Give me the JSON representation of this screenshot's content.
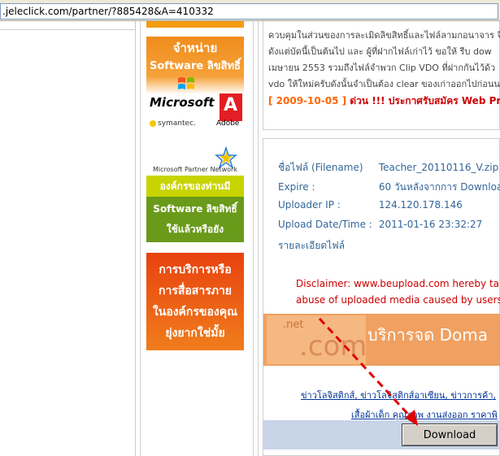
{
  "address_bar": {
    "url": ".jeleclick.com/partner/?885428&A=410332"
  },
  "banners": {
    "banner1": {
      "line1": "จำหน่าย",
      "line2": "Software ลิขสิทธิ์",
      "brand1": "Microsoft",
      "brand2": "symantec.",
      "brand3": "Adobe"
    },
    "banner2": {
      "network": "Microsoft Partner Network",
      "line1": "องค์กรของท่านมี",
      "line2": "Software ลิขสิทธิ์",
      "line3": "ใช้แล้วหรือยัง"
    },
    "banner3": {
      "line1": "การบริการหรือ",
      "line2": "การสื่อสารภาย",
      "line3": "ในองค์กรของคุณ",
      "line4": "ยุ่งยากใช่มั้ย"
    }
  },
  "news": {
    "lines": [
      "ควบคุมในส่วนของการละเมิดลิขสิทธิ์และไฟล์ลามกอนาจาร จึ",
      "ดังแต่บัดนี้เป็นต้นไป และ ผู้ที่ฝากไฟล์เก่าไว้ ขอให้ รีบ dow",
      "เมษายน 2553 รวมถึงไฟล์จำพวก Clip VDO ที่ฝากกันไว้ด้ว",
      "vdo ให้ใหม่ครับดังนั้นจำเป็นต้อง clear ของเก่าออกไปก่อนน"
    ],
    "date": "[ 2009-10-05 ]",
    "headline": "ด่วน !!! ประกาศรับสมัคร Web Pro"
  },
  "file_info": {
    "filename_label": "ชื่อไฟล์ (Filename)",
    "filename": "Teacher_20110116_V.zip",
    "expire_label": "Expire :",
    "expire": "60 วันหลังจากการ Downloa",
    "uploader_label": "Uploader IP :",
    "uploader_ip": "124.120.178.146",
    "date_label": "Upload Date/Time :",
    "date": "2011-01-16 23:32:27",
    "details_label": "รายละเอียดไฟล์"
  },
  "disclaimer": {
    "line1": "Disclaimer: www.beupload.com hereby takes",
    "line2": "abuse of uploaded media caused by users of "
  },
  "ad": {
    "net": ".net",
    "com": ".com",
    "title": "บริการจด Doma"
  },
  "links": {
    "line1": "ข่าวโลจิสติกส์, ข่าวโลจิสติกส์อาเซียน, ข่าวการค้า, ",
    "line2": "เสื้อผ้าเด็ก คุณภาพ งานส่งออก ราคาพิ"
  },
  "download": {
    "label": "Download"
  },
  "colors": {
    "arrow": "#e00000",
    "accent_orange": "#f39c12"
  }
}
